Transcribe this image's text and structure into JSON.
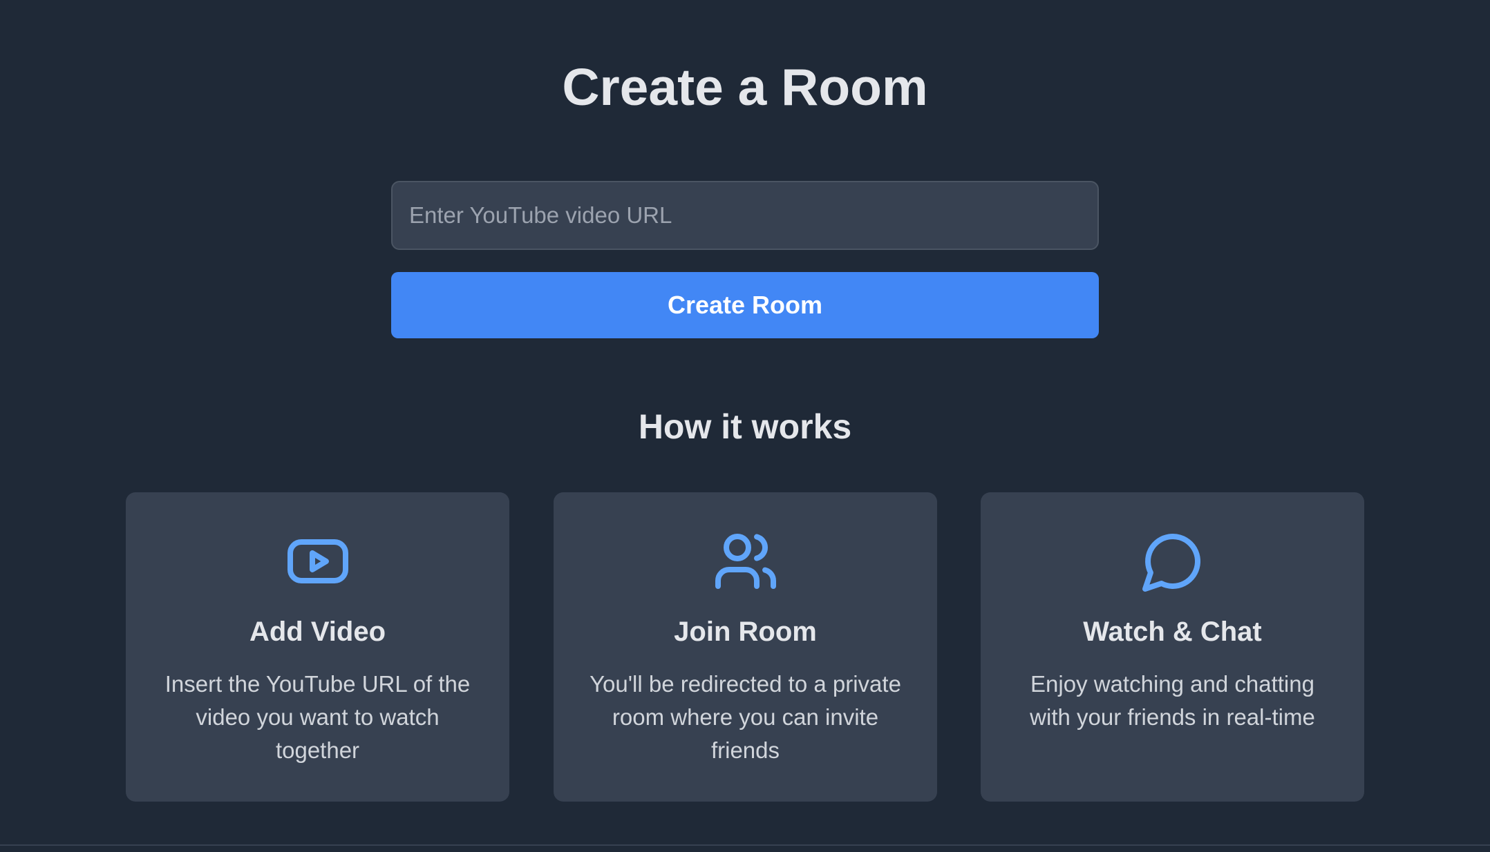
{
  "page": {
    "title": "Create a Room"
  },
  "form": {
    "url_placeholder": "Enter YouTube video URL",
    "url_value": "",
    "submit_label": "Create Room"
  },
  "how_it_works": {
    "heading": "How it works",
    "steps": [
      {
        "icon": "youtube-play-icon",
        "title": "Add Video",
        "description": "Insert the YouTube URL of the video you want to watch together"
      },
      {
        "icon": "users-icon",
        "title": "Join Room",
        "description": "You'll be redirected to a private room where you can invite friends"
      },
      {
        "icon": "chat-bubble-icon",
        "title": "Watch & Chat",
        "description": "Enjoy watching and chatting with your friends in real-time"
      }
    ]
  },
  "colors": {
    "background": "#1f2937",
    "card": "#374151",
    "accent": "#4287f5",
    "icon": "#60a5fa"
  }
}
